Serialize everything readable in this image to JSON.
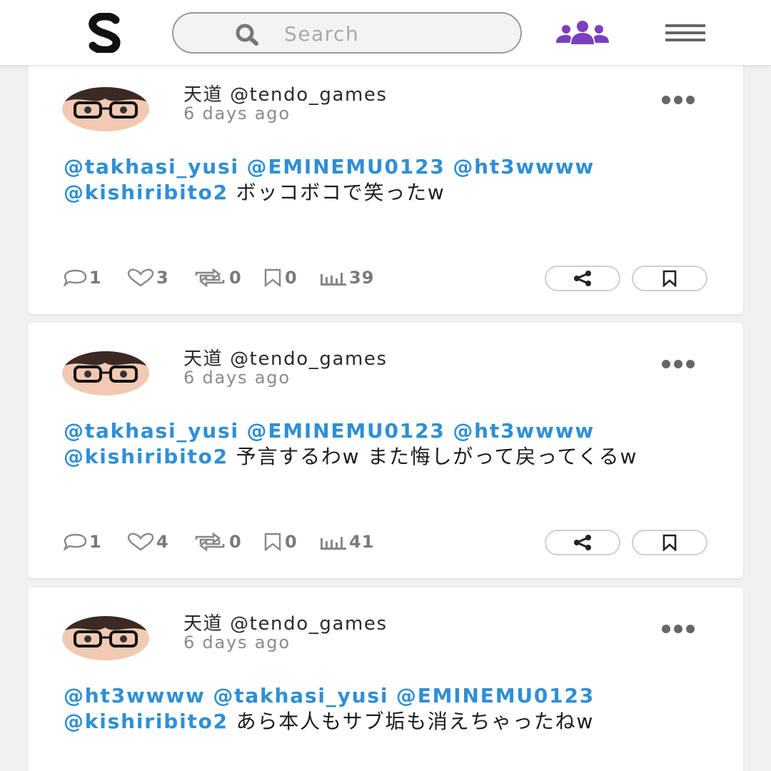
{
  "header": {
    "search_placeholder": "Search",
    "accent_color": "#7b3fbf"
  },
  "posts": [
    {
      "author": "天道 @tendo_games",
      "time": "6 days ago",
      "mentions": [
        "@takhasi_yusi",
        "@EMINEMU0123",
        "@ht3wwww",
        "@kishiribito2"
      ],
      "text": "ボッコボコで笑ったw",
      "stats": {
        "comments": "1",
        "likes": "3",
        "reposts": "0",
        "bookmarks": "0",
        "views": "39"
      }
    },
    {
      "author": "天道 @tendo_games",
      "time": "6 days ago",
      "mentions": [
        "@takhasi_yusi",
        "@EMINEMU0123",
        "@ht3wwww",
        "@kishiribito2"
      ],
      "text": "予言するわw また悔しがって戻ってくるw",
      "stats": {
        "comments": "1",
        "likes": "4",
        "reposts": "0",
        "bookmarks": "0",
        "views": "41"
      }
    },
    {
      "author": "天道 @tendo_games",
      "time": "6 days ago",
      "mentions": [
        "@ht3wwww",
        "@takhasi_yusi",
        "@EMINEMU0123",
        "@kishiribito2"
      ],
      "text": "あら本人もサブ垢も消えちゃったねw"
    }
  ]
}
